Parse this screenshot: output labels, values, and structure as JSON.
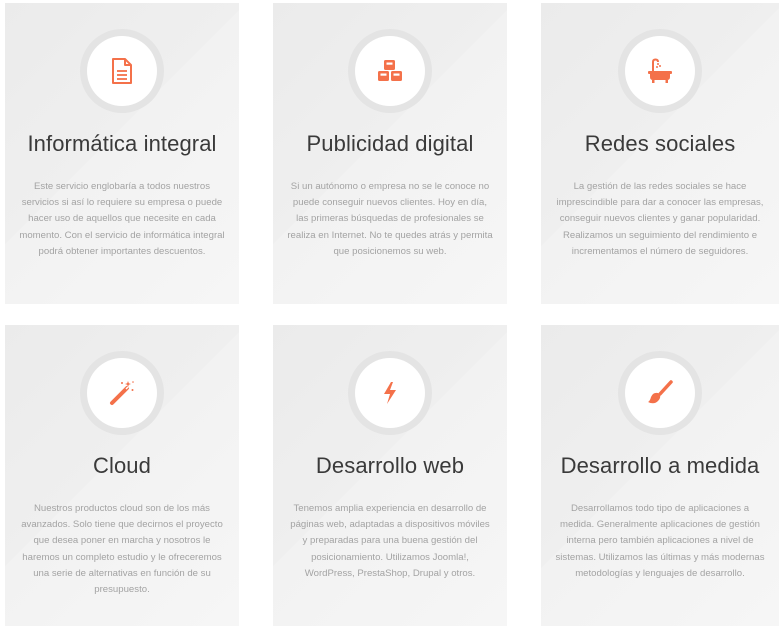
{
  "colors": {
    "accent": "#f4714a",
    "card_bg": "#efefef",
    "ring": "#e4e4e4",
    "title": "#3a3a3a",
    "text": "#a3a3a3"
  },
  "services": [
    {
      "icon": "document-icon",
      "title": "Informática integral",
      "text": "Este servicio englobaría a todos nuestros servicios si así lo requiere su empresa o puede hacer uso de aquellos que necesite en cada momento. Con el servicio de informática integral podrá obtener importantes descuentos."
    },
    {
      "icon": "cubes-icon",
      "title": "Publicidad digital",
      "text": "Si un autónomo o empresa no se le conoce no puede conseguir nuevos clientes. Hoy en día, las primeras búsquedas de profesionales se realiza en Internet. No te quedes atrás y permita que posicionemos su web."
    },
    {
      "icon": "bathtub-icon",
      "title": "Redes sociales",
      "text": "La gestión de las redes sociales se hace imprescindible para dar a conocer las empresas, conseguir nuevos clientes y ganar popularidad. Realizamos un seguimiento del rendimiento e incrementamos el número de seguidores."
    },
    {
      "icon": "magic-wand-icon",
      "title": "Cloud",
      "text": "Nuestros productos cloud son de los más avanzados. Solo tiene que decirnos el proyecto que desea poner en marcha y nosotros le haremos un completo estudio y le ofreceremos una serie de alternativas en función de su presupuesto."
    },
    {
      "icon": "bolt-icon",
      "title": "Desarrollo web",
      "text": "Tenemos amplia experiencia en desarrollo de páginas web, adaptadas a dispositivos móviles y preparadas para una buena gestión del posicionamiento. Utilizamos Joomla!, WordPress, PrestaShop, Drupal y otros."
    },
    {
      "icon": "paintbrush-icon",
      "title": "Desarrollo a medida",
      "text": "Desarrollamos todo tipo de aplicaciones a medida. Generalmente aplicaciones de gestión interna pero también aplicaciones a nivel de sistemas. Utilizamos las últimas y más modernas metodologías y lenguajes de desarrollo."
    }
  ]
}
